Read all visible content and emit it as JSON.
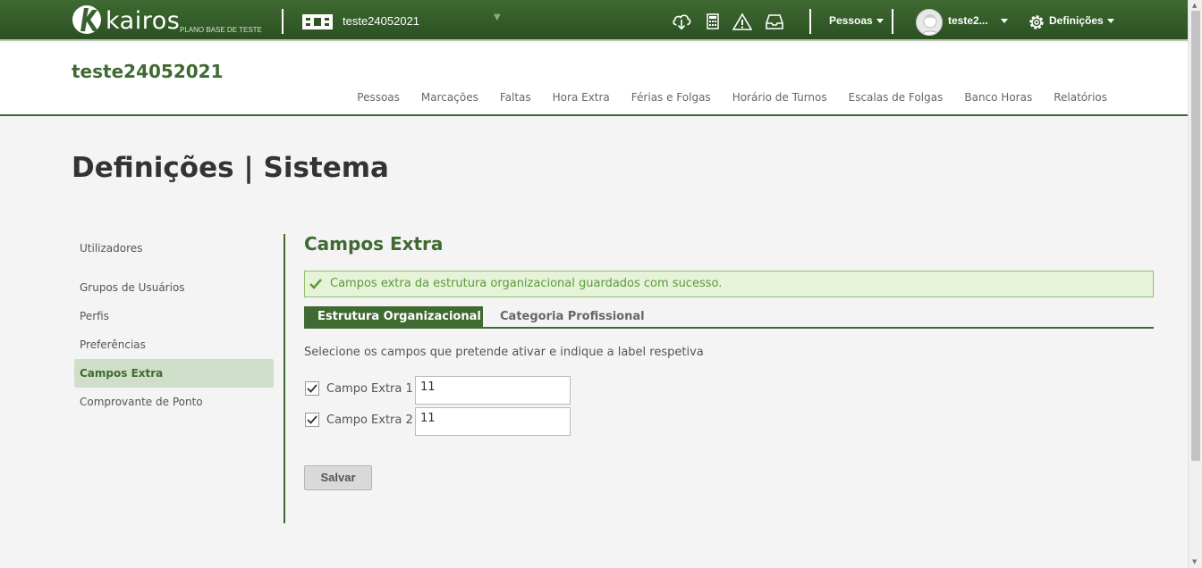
{
  "topbar": {
    "logo_word": "kairos",
    "logo_sub": "PLANO BASE DE TESTE",
    "company": "teste24052021",
    "icons": [
      "cloud-download-icon",
      "calculator-icon",
      "warning-icon",
      "inbox-icon"
    ],
    "menu_pessoas": "Pessoas",
    "user_name": "teste2...",
    "menu_definicoes": "Definições"
  },
  "header": {
    "company_title": "teste24052021",
    "nav": [
      "Pessoas",
      "Marcações",
      "Faltas",
      "Hora Extra",
      "Férias e Folgas",
      "Horário de Turnos",
      "Escalas de Folgas",
      "Banco Horas",
      "Relatórios"
    ]
  },
  "page_title": "Definições | Sistema",
  "sidebar": {
    "items": [
      {
        "label": "Utilizadores",
        "active": false
      },
      {
        "label": "Grupos de Usuários",
        "active": false
      },
      {
        "label": "Perfis",
        "active": false
      },
      {
        "label": "Preferências",
        "active": false
      },
      {
        "label": "Campos Extra",
        "active": true
      },
      {
        "label": "Comprovante de Ponto",
        "active": false
      }
    ]
  },
  "main": {
    "section_title": "Campos Extra",
    "alert": "Campos extra da estrutura organizacional guardados com sucesso.",
    "tabs": [
      {
        "label": "Estrutura Organizacional",
        "active": true
      },
      {
        "label": "Categoria Profissional",
        "active": false
      }
    ],
    "instructions": "Selecione os campos que pretende ativar e indique a label respetiva",
    "fields": [
      {
        "label": "Campo Extra 1",
        "checked": true,
        "value": "11"
      },
      {
        "label": "Campo Extra 2",
        "checked": true,
        "value": "11"
      }
    ],
    "save_label": "Salvar"
  },
  "colors": {
    "brand_green": "#3f6a32",
    "alert_bg": "#e6f3d9",
    "alert_text": "#5a9a3a"
  }
}
